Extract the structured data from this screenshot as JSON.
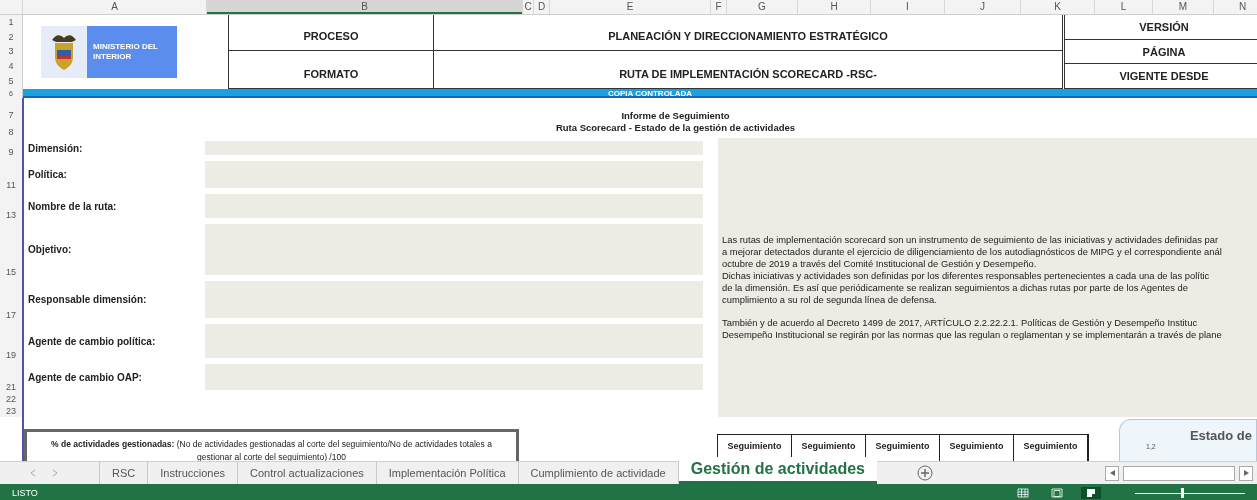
{
  "columns": [
    {
      "label": "A",
      "selected": false
    },
    {
      "label": "B",
      "selected": true
    },
    {
      "label": "C",
      "selected": false
    },
    {
      "label": "D",
      "selected": false
    },
    {
      "label": "E",
      "selected": false
    },
    {
      "label": "F",
      "selected": false
    },
    {
      "label": "G",
      "selected": false
    },
    {
      "label": "H",
      "selected": false
    },
    {
      "label": "I",
      "selected": false
    },
    {
      "label": "J",
      "selected": false
    },
    {
      "label": "K",
      "selected": false
    },
    {
      "label": "L",
      "selected": false
    },
    {
      "label": "M",
      "selected": false
    },
    {
      "label": "N",
      "selected": false
    }
  ],
  "header": {
    "row_numbers": [
      "1",
      "2",
      "3",
      "4",
      "5"
    ],
    "logo_text": "MINISTERIO DEL INTERIOR",
    "labels": [
      "PROCESO",
      "FORMATO"
    ],
    "values": [
      "PLANEACIÓN Y DIRECCIONAMIENTO ESTRATÉGICO",
      "RUTA DE IMPLEMENTACIÓN SCORECARD -RSC-"
    ],
    "meta": [
      "VERSIÓN",
      "PÁGINA",
      "VIGENTE DESDE"
    ]
  },
  "band": {
    "row_number": "6",
    "text": "COPIA CONTROLADA"
  },
  "title": {
    "row_numbers": [
      "7",
      "8"
    ],
    "lines": [
      "Informe de Seguimiento",
      "Ruta Scorecard - Estado de la gestión de actividades"
    ]
  },
  "form_rows": [
    {
      "row_number": "9",
      "label": "Dimensión:"
    },
    {
      "row_number": "11",
      "label": "Política:"
    },
    {
      "row_number": "13",
      "label": "Nombre de la ruta:"
    },
    {
      "row_number": "15",
      "label": "Objetivo:"
    },
    {
      "row_number": "17",
      "label": "Responsable dimensión:"
    },
    {
      "row_number": "19",
      "label": "Agente de cambio política:"
    },
    {
      "row_number": "21",
      "label": "Agente de cambio OAP:"
    }
  ],
  "blank_rows": [
    "22",
    "23"
  ],
  "description": [
    [
      "Las rutas de implementación scorecard son un instrumento de seguimiento de las iniciativas y actividades definidas par",
      "a mejorar detectados durante el ejercicio de diligenciamiento de los autodiagnósticos de MIPG y el correspondiente anál",
      "octubre de 2019 a través del Comité Institucional de Gestión y Desempeño.",
      "Dichas iniciativas y actividades son definidas por los diferentes responsables pertenecientes a cada una de las polític",
      "de la dimensión. Es así que periódicamente se realizan seguimientos a dichas rutas por parte de los Agentes de",
      "cumplimiento a su rol de segunda línea de defensa."
    ],
    [
      "También y de acuerdo al Decreto 1499 de 2017, ARTÍCULO 2.2.22.2.1. Políticas de Gestión y Desempeño Instituc",
      "Desempeño Institucional se regirán por las normas que las regulan o reglamentan y se implementarán a través de plane"
    ]
  ],
  "percent_box": "**% de actividades gestionadas:** (No de actividades gestionadas al corte del seguimiento/No de actividades totales a gestionar al corte del seguimiento) /100",
  "followup_headers": [
    "Seguimiento",
    "Seguimiento",
    "Seguimiento",
    "Seguimiento",
    "Seguimiento"
  ],
  "status_card": {
    "title": "Estado de",
    "axis_label": "1,2"
  },
  "sheet_tabs": [
    {
      "label": "RSC",
      "selected": false
    },
    {
      "label": "Instrucciones",
      "selected": false
    },
    {
      "label": "Control actualizaciones",
      "selected": false
    },
    {
      "label": "Implementación Política",
      "selected": false
    },
    {
      "label": "Cumplimiento de actividade",
      "selected": false
    },
    {
      "label": "Gestión de actividades",
      "selected": true
    }
  ],
  "status_bar": {
    "text": "LISTO",
    "views": [
      {
        "kind": "normal",
        "selected": false
      },
      {
        "kind": "layout",
        "selected": false
      },
      {
        "kind": "pagebreak",
        "selected": true
      }
    ],
    "zoom": {
      "level": 0.42
    }
  }
}
